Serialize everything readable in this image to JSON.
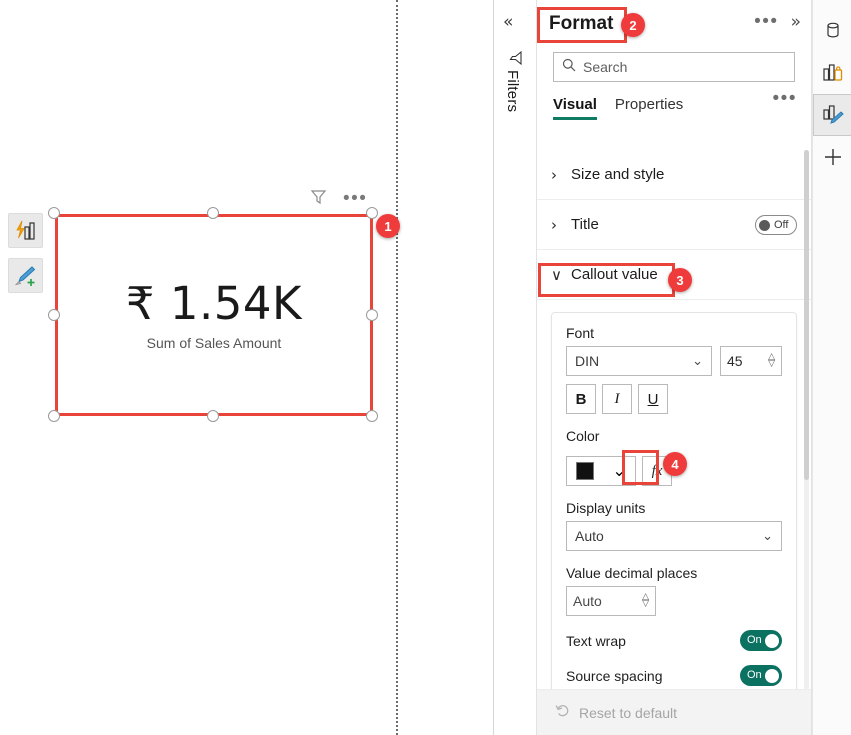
{
  "canvas": {
    "visual_toolbar": [
      {
        "name": "ai-insights-button",
        "tooltip": "AI insights"
      },
      {
        "name": "format-paint-button",
        "tooltip": "Apply formatting"
      }
    ],
    "card_header_icons": [
      {
        "name": "filter-icon"
      },
      {
        "name": "more-options-icon",
        "glyph": "•••"
      }
    ],
    "card": {
      "value": "₹ 1.54K",
      "label": "Sum of Sales Amount"
    }
  },
  "annotations": [
    {
      "id": "1",
      "number": "1",
      "target": "selected-card-visual"
    },
    {
      "id": "2",
      "number": "2",
      "target": "format-pane-title"
    },
    {
      "id": "3",
      "number": "3",
      "target": "callout-value-section"
    },
    {
      "id": "4",
      "number": "4",
      "target": "color-fx-button"
    }
  ],
  "filters_pane": {
    "collapse_glyph": "«",
    "label": "Filters",
    "icon": "funnel-icon"
  },
  "format_pane": {
    "title": "Format",
    "more_glyph": "•••",
    "expand_glyph": "»",
    "search": {
      "placeholder": "Search",
      "value": "",
      "icon": "search-icon"
    },
    "tabs": [
      {
        "label": "Visual",
        "active": true
      },
      {
        "label": "Properties",
        "active": false
      }
    ],
    "tabs_more_glyph": "•••",
    "sections": [
      {
        "name": "Size and style",
        "expanded": false,
        "chevron": "›",
        "toggle": null
      },
      {
        "name": "Title",
        "expanded": false,
        "chevron": "›",
        "toggle": "Off"
      },
      {
        "name": "Callout value",
        "expanded": true,
        "chevron": "∨",
        "toggle": null
      }
    ],
    "callout_value": {
      "font_label": "Font",
      "font_family": "DIN",
      "font_size": "45",
      "style_buttons": [
        {
          "label": "B",
          "name": "bold-button"
        },
        {
          "label": "I",
          "name": "italic-button"
        },
        {
          "label": "U",
          "name": "underline-button"
        }
      ],
      "color_label": "Color",
      "color_value": "#111111",
      "fx_label": "fx",
      "display_units_label": "Display units",
      "display_units_value": "Auto",
      "decimal_label": "Value decimal places",
      "decimal_value": "Auto",
      "text_wrap_label": "Text wrap",
      "text_wrap_state": "On",
      "source_spacing_label": "Source spacing",
      "source_spacing_state": "On"
    },
    "reset": {
      "label": "Reset to default",
      "icon": "undo-icon"
    }
  },
  "icon_rail": [
    {
      "name": "data-icon",
      "selected": false
    },
    {
      "name": "build-visual-icon",
      "selected": false
    },
    {
      "name": "format-visual-icon",
      "selected": true
    },
    {
      "name": "add-icon",
      "selected": false
    }
  ],
  "colors": {
    "accent_teal": "#0b7161",
    "annotation_red": "#e8443a",
    "badge_red": "#ef3b3b"
  }
}
